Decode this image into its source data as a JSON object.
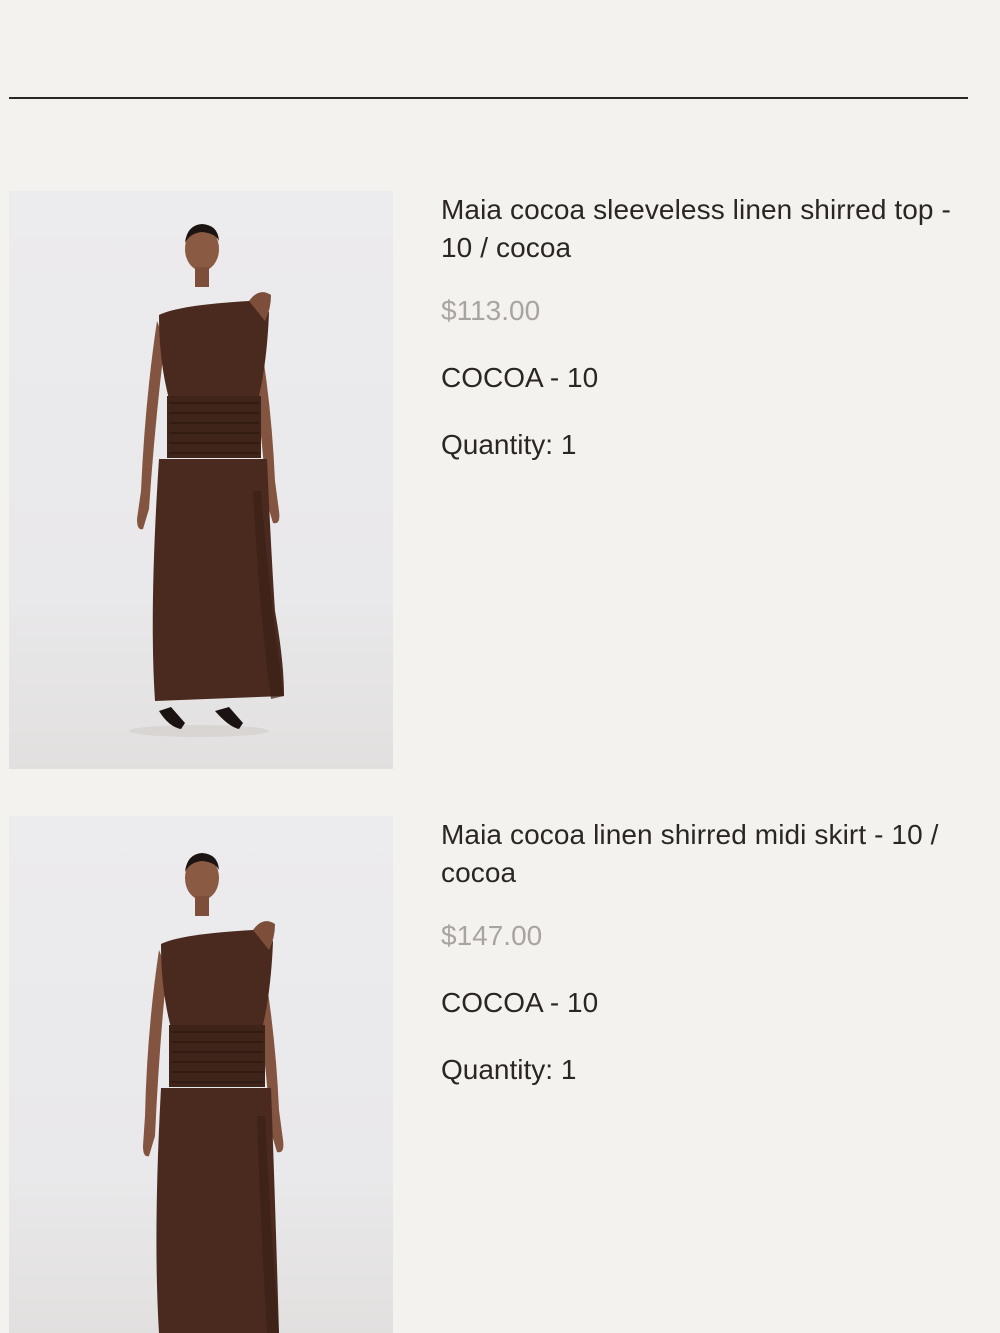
{
  "cart": {
    "items": [
      {
        "title": "Maia cocoa sleeveless linen shirred top - 10 / cocoa",
        "price": "$113.00",
        "variant": "COCOA - 10",
        "quantity_label": "Quantity: 1",
        "image_alt": "model-wearing-cocoa-linen-set"
      },
      {
        "title": "Maia cocoa linen shirred midi skirt - 10 / cocoa",
        "price": "$147.00",
        "variant": "COCOA - 10",
        "quantity_label": "Quantity: 1",
        "image_alt": "model-wearing-cocoa-linen-set"
      }
    ]
  },
  "colors": {
    "background": "#f4f2ef",
    "text": "#2b2623",
    "price": "#a8a4a1",
    "garment": "#4a2a1f"
  }
}
